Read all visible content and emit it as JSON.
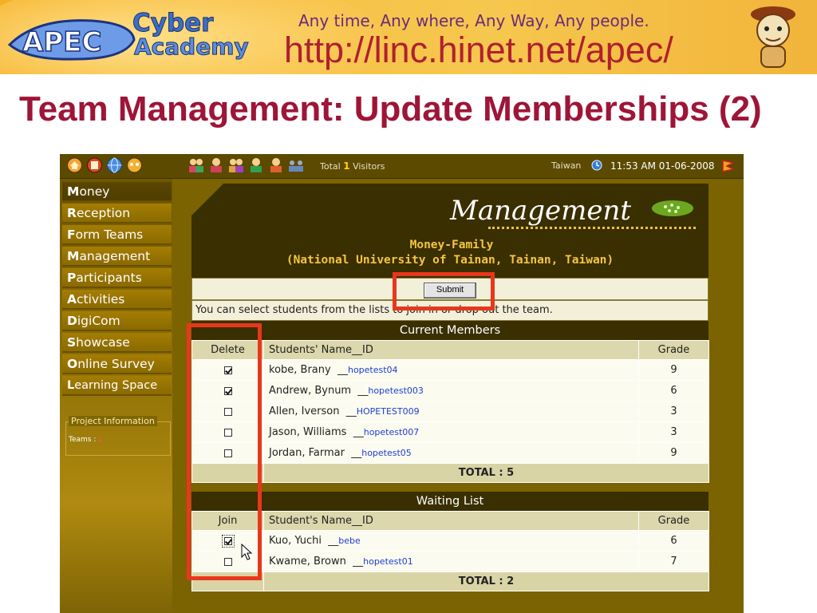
{
  "banner": {
    "logo_text": "APEC",
    "cyber": "Cyber",
    "academy": "Academy",
    "tagline": "Any time, Any where, Any Way, Any people.",
    "url": "http://linc.hinet.net/apec/"
  },
  "slide": {
    "title": "Team Management: Update Memberships (2)"
  },
  "topbar": {
    "visitors_prefix": "Total",
    "visitors_count": "1",
    "visitors_suffix": "Visitors",
    "region": "Taiwan",
    "datetime": "11:53 AM 01-06-2008"
  },
  "sidebar": {
    "items": [
      {
        "initial": "M",
        "rest": "oney"
      },
      {
        "initial": "R",
        "rest": "eception"
      },
      {
        "initial": "F",
        "rest": "orm Teams"
      },
      {
        "initial": "M",
        "rest": "anagement"
      },
      {
        "initial": "P",
        "rest": "articipants"
      },
      {
        "initial": "A",
        "rest": "ctivities"
      },
      {
        "initial": "D",
        "rest": "igiCom"
      },
      {
        "initial": "S",
        "rest": "howcase"
      },
      {
        "initial": "O",
        "rest": "nline Survey"
      },
      {
        "initial": "L",
        "rest": "earning Space"
      }
    ],
    "project_info_label": "Project Information",
    "teams_label": "Teams :",
    "teams_value": "2"
  },
  "content": {
    "heading": "Management",
    "team_name": "Money-Family",
    "team_school": "(National University of Tainan, Tainan, Taiwan)",
    "submit_label": "Submit",
    "help_text": "You can select students from the lists to join in or drop out the team.",
    "current": {
      "title": "Current Members",
      "col_action": "Delete",
      "col_name": "Students' Name__ID",
      "col_grade": "Grade",
      "rows": [
        {
          "name": "kobe, Brany",
          "id": "hopetest04",
          "grade": "9",
          "checked": true
        },
        {
          "name": "Andrew, Bynum",
          "id": "hopetest003",
          "grade": "6",
          "checked": true
        },
        {
          "name": "Allen, Iverson",
          "id": "HOPETEST009",
          "grade": "3",
          "checked": false
        },
        {
          "name": "Jason, Williams",
          "id": "hopetest007",
          "grade": "3",
          "checked": false
        },
        {
          "name": "Jordan, Farmar",
          "id": "hopetest05",
          "grade": "9",
          "checked": false
        }
      ],
      "total": "TOTAL : 5"
    },
    "waiting": {
      "title": "Waiting List",
      "col_action": "Join",
      "col_name": "Student's Name__ID",
      "col_grade": "Grade",
      "rows": [
        {
          "name": "Kuo, Yuchi",
          "id": "bebe",
          "grade": "6",
          "checked": true
        },
        {
          "name": "Kwame, Brown",
          "id": "hopetest01",
          "grade": "7",
          "checked": false
        }
      ],
      "total": "TOTAL : 2"
    }
  },
  "colors": {
    "title": "#9e1537",
    "highlight": "#e8371c",
    "content_dark": "#3a2f00",
    "content_frame": "#7a6300",
    "accent_gold": "#f5c542",
    "id_link": "#1f3fd0"
  }
}
